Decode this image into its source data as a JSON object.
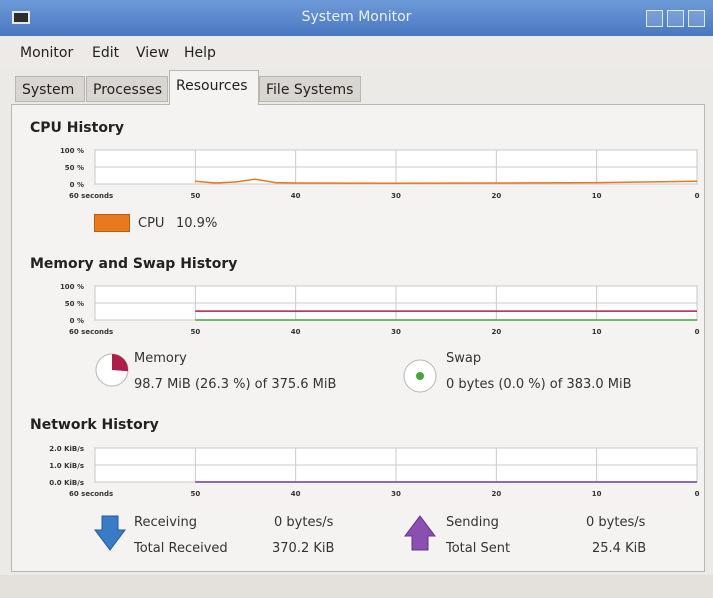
{
  "window": {
    "title": "System Monitor"
  },
  "menu": [
    "Monitor",
    "Edit",
    "View",
    "Help"
  ],
  "tabs": [
    "System",
    "Processes",
    "Resources",
    "File Systems"
  ],
  "active_tab": "Resources",
  "x_ticks": [
    "60 seconds",
    "50",
    "40",
    "30",
    "20",
    "10",
    "0"
  ],
  "cpu": {
    "title": "CPU History",
    "y_ticks": [
      "100 %",
      "50 %",
      "0 %"
    ],
    "legend_label": "CPU",
    "legend_value": "10.9%",
    "color": "#e8791f"
  },
  "memory_swap": {
    "title": "Memory and Swap History",
    "y_ticks": [
      "100 %",
      "50 %",
      "0 %"
    ],
    "memory": {
      "label": "Memory",
      "detail": "98.7 MiB (26.3 %) of 375.6 MiB",
      "color": "#ad1f4a",
      "percent": 26.3
    },
    "swap": {
      "label": "Swap",
      "detail": "0 bytes (0.0 %) of 383.0 MiB",
      "color": "#4aa33b",
      "percent": 0.0
    }
  },
  "network": {
    "title": "Network History",
    "y_ticks": [
      "2.0 KiB/s",
      "1.0 KiB/s",
      "0.0 KiB/s"
    ],
    "receiving_label": "Receiving",
    "receiving_value": "0 bytes/s",
    "total_received_label": "Total Received",
    "total_received_value": "370.2 KiB",
    "sending_label": "Sending",
    "sending_value": "0 bytes/s",
    "total_sent_label": "Total Sent",
    "total_sent_value": "25.4 KiB",
    "receiving_color": "#3a7bc8",
    "sending_color": "#8a4fb0"
  },
  "chart_data": [
    {
      "type": "line",
      "title": "CPU History",
      "xlabel": "",
      "ylabel": "",
      "x": [
        60,
        50,
        48,
        46,
        44,
        42,
        40,
        30,
        20,
        10,
        0
      ],
      "x_tick_labels": [
        "60 seconds",
        "50",
        "40",
        "30",
        "20",
        "10",
        "0"
      ],
      "ylim": [
        0,
        100
      ],
      "series": [
        {
          "name": "CPU",
          "values": [
            null,
            8,
            3,
            6,
            14,
            4,
            3,
            2,
            3,
            4,
            8
          ]
        }
      ]
    },
    {
      "type": "line",
      "title": "Memory and Swap History",
      "xlabel": "",
      "ylabel": "",
      "x": [
        50,
        40,
        30,
        20,
        10,
        0
      ],
      "x_tick_labels": [
        "60 seconds",
        "50",
        "40",
        "30",
        "20",
        "10",
        "0"
      ],
      "ylim": [
        0,
        100
      ],
      "series": [
        {
          "name": "Memory",
          "values": [
            26.3,
            26.3,
            26.3,
            26.3,
            26.3,
            26.3
          ]
        },
        {
          "name": "Swap",
          "values": [
            0,
            0,
            0,
            0,
            0,
            0
          ]
        }
      ]
    },
    {
      "type": "line",
      "title": "Network History",
      "xlabel": "",
      "ylabel": "",
      "x": [
        50,
        40,
        30,
        20,
        10,
        0
      ],
      "x_tick_labels": [
        "60 seconds",
        "50",
        "40",
        "30",
        "20",
        "10",
        "0"
      ],
      "ylim": [
        0,
        2
      ],
      "series": [
        {
          "name": "Receiving",
          "values": [
            0,
            0,
            0,
            0,
            0,
            0
          ]
        },
        {
          "name": "Sending",
          "values": [
            0,
            0,
            0,
            0,
            0,
            0
          ]
        }
      ]
    }
  ]
}
